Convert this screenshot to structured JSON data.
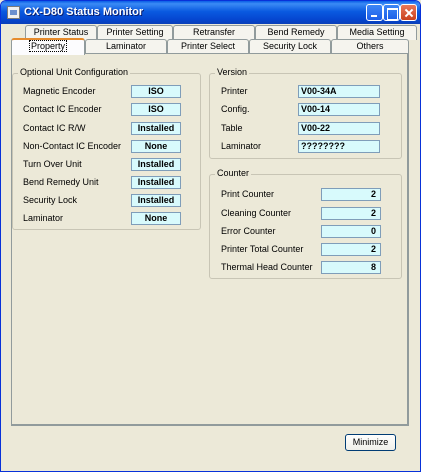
{
  "window": {
    "title": "CX-D80 Status Monitor"
  },
  "tabs_row1": [
    "Printer Status",
    "Printer Setting",
    "Retransfer",
    "Bend Remedy",
    "Media Setting"
  ],
  "tabs_row2": [
    "Property",
    "Laminator",
    "Printer Select",
    "Security Lock",
    "Others"
  ],
  "active_tab": "Property",
  "optional_unit": {
    "title": "Optional Unit Configuration",
    "rows": [
      {
        "label": "Magnetic Encoder",
        "value": "ISO"
      },
      {
        "label": "Contact IC Encoder",
        "value": "ISO"
      },
      {
        "label": "Contact IC R/W",
        "value": "Installed"
      },
      {
        "label": "Non-Contact IC Encoder",
        "value": "None"
      },
      {
        "label": "Turn Over Unit",
        "value": "Installed"
      },
      {
        "label": "Bend Remedy Unit",
        "value": "Installed"
      },
      {
        "label": "Security Lock",
        "value": "Installed"
      },
      {
        "label": "Laminator",
        "value": "None"
      }
    ]
  },
  "version": {
    "title": "Version",
    "rows": [
      {
        "label": "Printer",
        "value": "V00-34A"
      },
      {
        "label": "Config.",
        "value": "V00-14"
      },
      {
        "label": "Table",
        "value": "V00-22"
      },
      {
        "label": "Laminator",
        "value": "????????"
      }
    ]
  },
  "counter": {
    "title": "Counter",
    "rows": [
      {
        "label": "Print Counter",
        "value": "2"
      },
      {
        "label": "Cleaning Counter",
        "value": "2"
      },
      {
        "label": "Error Counter",
        "value": "0"
      },
      {
        "label": "Printer Total Counter",
        "value": "2"
      },
      {
        "label": "Thermal Head Counter",
        "value": "8"
      }
    ]
  },
  "footer": {
    "minimize_label": "Minimize"
  }
}
